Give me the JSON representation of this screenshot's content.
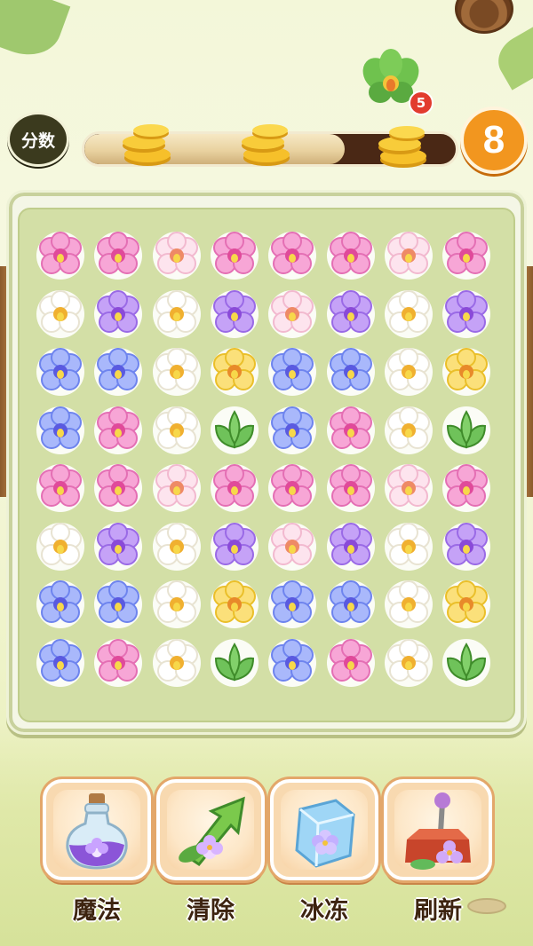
{
  "hud": {
    "score_label": "分数",
    "progress_fraction": 0.7,
    "target": {
      "icon": "orchid-target-icon",
      "count": "5"
    },
    "moves_left": "8"
  },
  "colors": {
    "pink": "#f07ec0",
    "white": "#ffffff",
    "purple": "#a06ef0",
    "blue": "#7486f2",
    "yellow": "#f7d24a",
    "leaf": "#62ba5a"
  },
  "board": {
    "rows": [
      [
        "pink",
        "pink",
        "blush",
        "pink",
        "pink",
        "pink",
        "blush",
        "pink"
      ],
      [
        "white",
        "purple",
        "white",
        "purple",
        "blush",
        "purple",
        "white",
        "purple"
      ],
      [
        "blue",
        "blue",
        "white",
        "yellow",
        "blue",
        "blue",
        "white",
        "yellow"
      ],
      [
        "blue",
        "pink",
        "white",
        "leaf",
        "blue",
        "pink",
        "white",
        "leaf"
      ],
      [
        "pink",
        "pink",
        "blush",
        "pink",
        "pink",
        "pink",
        "blush",
        "pink"
      ],
      [
        "white",
        "purple",
        "white",
        "purple",
        "blush",
        "purple",
        "white",
        "purple"
      ],
      [
        "blue",
        "blue",
        "white",
        "yellow",
        "blue",
        "blue",
        "white",
        "yellow"
      ],
      [
        "blue",
        "pink",
        "white",
        "leaf",
        "blue",
        "pink",
        "white",
        "leaf"
      ]
    ]
  },
  "tools": [
    {
      "label": "魔法",
      "icon": "magic-potion-icon"
    },
    {
      "label": "清除",
      "icon": "clear-arrow-icon"
    },
    {
      "label": "冰冻",
      "icon": "ice-cube-icon"
    },
    {
      "label": "刷新",
      "icon": "refresh-lever-icon"
    }
  ]
}
